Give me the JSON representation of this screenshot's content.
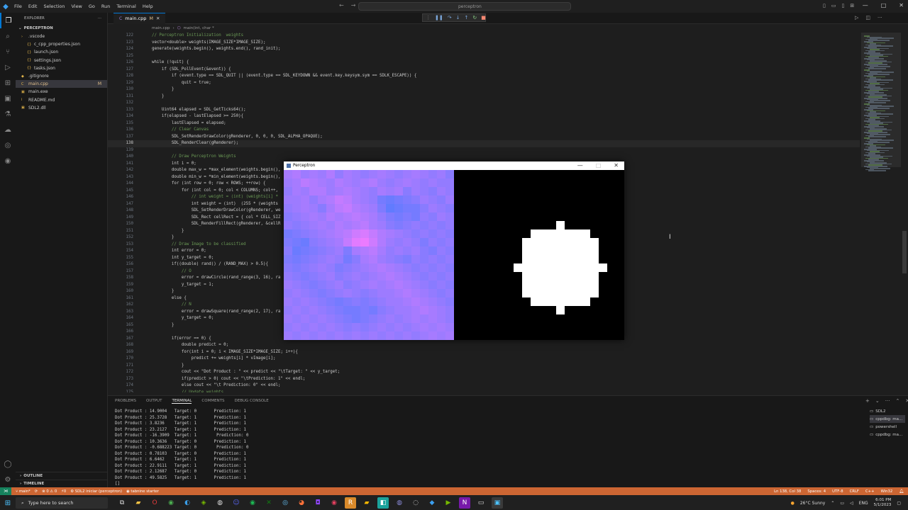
{
  "titlebar": {
    "menu": [
      "File",
      "Edit",
      "Selection",
      "View",
      "Go",
      "Run",
      "Terminal",
      "Help"
    ],
    "search_text": "perceptron",
    "window_controls": [
      "—",
      "□",
      "✕"
    ]
  },
  "sidebar": {
    "header": "EXPLORER",
    "root": "PERCEPTRON",
    "items": [
      {
        "label": ".vscode",
        "depth": 1,
        "icon": "›",
        "badge": ""
      },
      {
        "label": "c_cpp_properties.json",
        "depth": 2,
        "icon": "{}",
        "badge": ""
      },
      {
        "label": "launch.json",
        "depth": 2,
        "icon": "{}",
        "badge": ""
      },
      {
        "label": "settings.json",
        "depth": 2,
        "icon": "{}",
        "badge": ""
      },
      {
        "label": "tasks.json",
        "depth": 2,
        "icon": "{}",
        "badge": ""
      },
      {
        "label": ".gitignore",
        "depth": 1,
        "icon": "◆",
        "badge": ""
      },
      {
        "label": "main.cpp",
        "depth": 1,
        "icon": "C",
        "badge": "M"
      },
      {
        "label": "main.exe",
        "depth": 1,
        "icon": "▣",
        "badge": ""
      },
      {
        "label": "README.md",
        "depth": 1,
        "icon": "i",
        "badge": ""
      },
      {
        "label": "SDL2.dll",
        "depth": 1,
        "icon": "▣",
        "badge": ""
      }
    ],
    "outline": "OUTLINE",
    "timeline": "TIMELINE"
  },
  "tab": {
    "label": "main.cpp",
    "modified": "M"
  },
  "breadcrumb": [
    "main.cpp",
    "main(int, char *"
  ],
  "code": [
    {
      "n": "122",
      "t": "    // Perceptron Initialization  weights",
      "c": true
    },
    {
      "n": "123",
      "t": "    vector<double> weights(IMAGE_SIZE*IMAGE_SIZE);"
    },
    {
      "n": "124",
      "t": "    generate(weights.begin(), weights.end(), rand_init);"
    },
    {
      "n": "125",
      "t": ""
    },
    {
      "n": "126",
      "t": "    while (!quit) {"
    },
    {
      "n": "127",
      "t": "        if (SDL_PollEvent(&event)) {"
    },
    {
      "n": "128",
      "t": "            if (event.type == SDL_QUIT || (event.type == SDL_KEYDOWN && event.key.keysym.sym == SDLK_ESCAPE)) {"
    },
    {
      "n": "129",
      "t": "                quit = true;"
    },
    {
      "n": "130",
      "t": "            }"
    },
    {
      "n": "131",
      "t": "        }"
    },
    {
      "n": "132",
      "t": ""
    },
    {
      "n": "133",
      "t": "        Uint64 elapsed = SDL_GetTicks64();"
    },
    {
      "n": "134",
      "t": "        if(elapsed - lastElapsed >= 250){"
    },
    {
      "n": "135",
      "t": "            lastElapsed = elapsed;"
    },
    {
      "n": "136",
      "t": "            // Clear Canvas",
      "c": true
    },
    {
      "n": "137",
      "t": "            SDL_SetRenderDrawColor(gRenderer, 0, 0, 0, SDL_ALPHA_OPAQUE);"
    },
    {
      "n": "138",
      "t": "            SDL_RenderClear(gRenderer);",
      "cur": true
    },
    {
      "n": "139",
      "t": ""
    },
    {
      "n": "140",
      "t": "            // Draw Perceptron Weights",
      "c": true
    },
    {
      "n": "141",
      "t": "            int i = 0;"
    },
    {
      "n": "142",
      "t": "            double max_w = *max_element(weights.begin(),"
    },
    {
      "n": "143",
      "t": "            double min_w = *min_element(weights.begin(),"
    },
    {
      "n": "144",
      "t": "            for (int row = 0; row < ROWS; ++row) {"
    },
    {
      "n": "145",
      "t": "                for (int col = 0; col < COLUMNS; col++,"
    },
    {
      "n": "146",
      "t": "                    // int weight = (int) (weights[i] *",
      "c": true
    },
    {
      "n": "147",
      "t": "                    int weight = (int)  (255 * (weights"
    },
    {
      "n": "148",
      "t": "                    SDL_SetRenderDrawColor(gRenderer, we"
    },
    {
      "n": "149",
      "t": "                    SDL_Rect cellRect = { col * CELL_SIZ"
    },
    {
      "n": "150",
      "t": "                    SDL_RenderFillRect(gRenderer, &cellR"
    },
    {
      "n": "151",
      "t": "                }"
    },
    {
      "n": "152",
      "t": "            }"
    },
    {
      "n": "153",
      "t": "            // Draw Image to be classified",
      "c": true
    },
    {
      "n": "154",
      "t": "            int error = 0;"
    },
    {
      "n": "155",
      "t": "            int y_target = 0;"
    },
    {
      "n": "156",
      "t": "            if((double) rand() / (RAND_MAX) > 0.5){"
    },
    {
      "n": "157",
      "t": "                // O",
      "c": true
    },
    {
      "n": "158",
      "t": "                error = drawCircle(rand_range(3, 16), ra"
    },
    {
      "n": "159",
      "t": "                y_target = 1;"
    },
    {
      "n": "160",
      "t": "            }"
    },
    {
      "n": "161",
      "t": "            else {"
    },
    {
      "n": "162",
      "t": "                // N",
      "c": true
    },
    {
      "n": "163",
      "t": "                error = drawSquare(rand_range(2, 17), ra"
    },
    {
      "n": "164",
      "t": "                y_target = 0;"
    },
    {
      "n": "165",
      "t": "            }"
    },
    {
      "n": "166",
      "t": ""
    },
    {
      "n": "167",
      "t": "            if(error == 0) {"
    },
    {
      "n": "168",
      "t": "                double predict = 0;"
    },
    {
      "n": "169",
      "t": "                for(int i = 0; i < IMAGE_SIZE*IMAGE_SIZE; i++){"
    },
    {
      "n": "170",
      "t": "                    predict += weights[i] * vImage[i];"
    },
    {
      "n": "171",
      "t": "                }"
    },
    {
      "n": "172",
      "t": "                cout << \"Dot Product : \" << predict << \"\\tTarget: \" << y_target;"
    },
    {
      "n": "173",
      "t": "                if(predict > 0) cout << \"\\tPrediction: 1\" << endl;"
    },
    {
      "n": "174",
      "t": "                else cout << \"\\t Prediction: 0\" << endl;"
    },
    {
      "n": "175",
      "t": "                // Update weights",
      "c": true
    }
  ],
  "panel": {
    "tabs": [
      "PROBLEMS",
      "OUTPUT",
      "TERMINAL",
      "COMMENTS",
      "DEBUG CONSOLE"
    ],
    "active_tab": "TERMINAL",
    "terminal_lines": [
      "Dot Product : 14.9004   Target: 0       Prediction: 1",
      "Dot Product : 25.3728   Target: 1       Prediction: 1",
      "Dot Product : 3.8236    Target: 1       Prediction: 1",
      "Dot Product : 23.2127   Target: 1       Prediction: 1",
      "Dot Product : -16.3909  Target: 1        Prediction: 0",
      "Dot Product : 10.3636   Target: 0       Prediction: 1",
      "Dot Product : -0.688223 Target: 0        Prediction: 0",
      "Dot Product : 0.78103   Target: 0       Prediction: 1",
      "Dot Product : 6.6462    Target: 1       Prediction: 1",
      "Dot Product : 22.9111   Target: 1       Prediction: 1",
      "Dot Product : 2.12687   Target: 0       Prediction: 1",
      "Dot Product : 49.5825   Target: 1       Prediction: 1",
      "[]"
    ],
    "terminals": [
      "SDL2",
      "cppdbg: ma...",
      "powershell",
      "cppdbg: ma..."
    ]
  },
  "statusbar": {
    "branch": "main*",
    "sync": "⟳",
    "errors": "⊗ 0 ⚠ 0",
    "ports": "⚡0",
    "launch": "SDL2 iniciar (perceptron)",
    "tabnine": "tabnine starter",
    "position": "Ln 138, Col 38",
    "spaces": "Spaces: 4",
    "encoding": "UTF-8",
    "eol": "CRLF",
    "lang": "C++",
    "platform": "Win32"
  },
  "taskbar": {
    "search_placeholder": "Type here to search",
    "weather": "26°C  Sunny",
    "lang": "ENG",
    "time": "6:01 PM",
    "date": "5/1/2023"
  },
  "perceptron_window": {
    "title": "Perceptron",
    "colors": {
      "low": "#3a7bff",
      "high": "#ff7bff"
    },
    "grid": 20,
    "weights": [
      [
        0.55,
        0.6,
        0.5,
        0.55,
        0.5,
        0.6,
        0.45,
        0.55,
        0.5,
        0.45,
        0.5,
        0.55,
        0.5,
        0.45,
        0.5,
        0.55,
        0.5,
        0.45,
        0.5,
        0.4
      ],
      [
        0.5,
        0.55,
        0.65,
        0.6,
        0.55,
        0.5,
        0.6,
        0.55,
        0.5,
        0.55,
        0.6,
        0.5,
        0.45,
        0.5,
        0.55,
        0.5,
        0.45,
        0.5,
        0.45,
        0.45
      ],
      [
        0.45,
        0.55,
        0.5,
        0.6,
        0.6,
        0.5,
        0.55,
        0.6,
        0.55,
        0.5,
        0.45,
        0.55,
        0.5,
        0.55,
        0.4,
        0.5,
        0.45,
        0.4,
        0.5,
        0.45
      ],
      [
        0.5,
        0.5,
        0.55,
        0.45,
        0.55,
        0.6,
        0.7,
        0.65,
        0.55,
        0.5,
        0.45,
        0.3,
        0.25,
        0.3,
        0.35,
        0.4,
        0.5,
        0.45,
        0.4,
        0.5
      ],
      [
        0.45,
        0.5,
        0.55,
        0.5,
        0.4,
        0.55,
        0.65,
        0.7,
        0.6,
        0.55,
        0.5,
        0.35,
        0.2,
        0.25,
        0.3,
        0.3,
        0.4,
        0.5,
        0.45,
        0.4
      ],
      [
        0.4,
        0.45,
        0.5,
        0.55,
        0.5,
        0.6,
        0.55,
        0.6,
        0.65,
        0.6,
        0.55,
        0.45,
        0.35,
        0.3,
        0.35,
        0.3,
        0.45,
        0.4,
        0.5,
        0.45
      ],
      [
        0.45,
        0.4,
        0.45,
        0.5,
        0.55,
        0.5,
        0.6,
        0.55,
        0.6,
        0.65,
        0.55,
        0.5,
        0.4,
        0.35,
        0.4,
        0.45,
        0.4,
        0.45,
        0.4,
        0.45
      ],
      [
        0.3,
        0.35,
        0.4,
        0.45,
        0.5,
        0.55,
        0.6,
        0.65,
        0.75,
        0.8,
        0.7,
        0.6,
        0.55,
        0.5,
        0.45,
        0.4,
        0.45,
        0.4,
        0.45,
        0.4
      ],
      [
        0.35,
        0.3,
        0.25,
        0.4,
        0.45,
        0.5,
        0.55,
        0.7,
        0.85,
        0.9,
        0.75,
        0.6,
        0.5,
        0.45,
        0.5,
        0.45,
        0.35,
        0.45,
        0.4,
        0.45
      ],
      [
        0.4,
        0.25,
        0.3,
        0.35,
        0.4,
        0.45,
        0.5,
        0.35,
        0.55,
        0.6,
        0.65,
        0.55,
        0.45,
        0.5,
        0.45,
        0.5,
        0.4,
        0.35,
        0.45,
        0.4
      ],
      [
        0.35,
        0.3,
        0.35,
        0.4,
        0.45,
        0.5,
        0.45,
        0.3,
        0.4,
        0.55,
        0.6,
        0.5,
        0.45,
        0.4,
        0.35,
        0.45,
        0.4,
        0.45,
        0.4,
        0.45
      ],
      [
        0.4,
        0.35,
        0.4,
        0.45,
        0.5,
        0.45,
        0.35,
        0.4,
        0.45,
        0.5,
        0.55,
        0.6,
        0.55,
        0.5,
        0.45,
        0.4,
        0.45,
        0.4,
        0.45,
        0.4
      ],
      [
        0.45,
        0.4,
        0.35,
        0.4,
        0.45,
        0.5,
        0.4,
        0.45,
        0.5,
        0.45,
        0.5,
        0.55,
        0.6,
        0.55,
        0.5,
        0.45,
        0.4,
        0.45,
        0.4,
        0.45
      ],
      [
        0.5,
        0.45,
        0.4,
        0.35,
        0.4,
        0.45,
        0.5,
        0.4,
        0.45,
        0.5,
        0.55,
        0.5,
        0.55,
        0.6,
        0.55,
        0.5,
        0.45,
        0.4,
        0.45,
        0.4
      ],
      [
        0.45,
        0.5,
        0.45,
        0.4,
        0.35,
        0.4,
        0.45,
        0.5,
        0.45,
        0.4,
        0.45,
        0.5,
        0.5,
        0.55,
        0.6,
        0.55,
        0.5,
        0.45,
        0.4,
        0.45
      ],
      [
        0.5,
        0.45,
        0.5,
        0.45,
        0.4,
        0.35,
        0.3,
        0.35,
        0.4,
        0.35,
        0.4,
        0.45,
        0.5,
        0.5,
        0.55,
        0.6,
        0.55,
        0.5,
        0.45,
        0.4
      ],
      [
        0.45,
        0.5,
        0.45,
        0.5,
        0.45,
        0.4,
        0.35,
        0.3,
        0.3,
        0.35,
        0.3,
        0.4,
        0.45,
        0.5,
        0.5,
        0.55,
        0.6,
        0.55,
        0.5,
        0.45
      ],
      [
        0.5,
        0.45,
        0.5,
        0.45,
        0.5,
        0.45,
        0.4,
        0.35,
        0.3,
        0.35,
        0.4,
        0.45,
        0.5,
        0.45,
        0.5,
        0.55,
        0.5,
        0.55,
        0.5,
        0.45
      ],
      [
        0.45,
        0.5,
        0.45,
        0.5,
        0.45,
        0.5,
        0.45,
        0.4,
        0.45,
        0.4,
        0.45,
        0.5,
        0.45,
        0.5,
        0.45,
        0.5,
        0.55,
        0.5,
        0.55,
        0.5
      ],
      [
        0.5,
        0.45,
        0.5,
        0.45,
        0.5,
        0.45,
        0.5,
        0.45,
        0.5,
        0.45,
        0.5,
        0.45,
        0.5,
        0.45,
        0.5,
        0.45,
        0.5,
        0.55,
        0.5,
        0.55
      ]
    ],
    "shape": [
      [
        0,
        0,
        0,
        0,
        0,
        0,
        0,
        0,
        0,
        0,
        0,
        0,
        0,
        0,
        0,
        0,
        0,
        0,
        0,
        0
      ],
      [
        0,
        0,
        0,
        0,
        0,
        0,
        0,
        0,
        0,
        0,
        0,
        0,
        0,
        0,
        0,
        0,
        0,
        0,
        0,
        0
      ],
      [
        0,
        0,
        0,
        0,
        0,
        0,
        0,
        0,
        0,
        0,
        0,
        0,
        0,
        0,
        0,
        0,
        0,
        0,
        0,
        0
      ],
      [
        0,
        0,
        0,
        0,
        0,
        0,
        0,
        0,
        0,
        0,
        0,
        0,
        0,
        0,
        0,
        0,
        0,
        0,
        0,
        0
      ],
      [
        0,
        0,
        0,
        0,
        0,
        0,
        0,
        0,
        0,
        0,
        0,
        0,
        0,
        0,
        0,
        0,
        0,
        0,
        0,
        0
      ],
      [
        0,
        0,
        0,
        0,
        0,
        0,
        0,
        0,
        0,
        0,
        0,
        0,
        0,
        0,
        0,
        0,
        0,
        0,
        0,
        0
      ],
      [
        0,
        0,
        0,
        0,
        0,
        0,
        0,
        0,
        0,
        0,
        0,
        0,
        0,
        0,
        0,
        0,
        0,
        0,
        0,
        0
      ],
      [
        0,
        0,
        0,
        0,
        0,
        0,
        0,
        0,
        0,
        0,
        0,
        0,
        0,
        0,
        0,
        0,
        0,
        0,
        0,
        0
      ],
      [
        0,
        0,
        0,
        0,
        0,
        0,
        0,
        0,
        0,
        0,
        0,
        0,
        0,
        0,
        0,
        0,
        0,
        0,
        0,
        0
      ],
      [
        0,
        0,
        0,
        0,
        0,
        0,
        0,
        0,
        0,
        0,
        0,
        0,
        0,
        0,
        0,
        0,
        0,
        0,
        0,
        0
      ],
      [
        0,
        0,
        0,
        0,
        0,
        0,
        0,
        0,
        0,
        0,
        0,
        0,
        0,
        0,
        0,
        0,
        0,
        0,
        0,
        0
      ],
      [
        0,
        0,
        0,
        0,
        0,
        0,
        0,
        0,
        0,
        0,
        0,
        0,
        0,
        0,
        0,
        0,
        0,
        0,
        0,
        0
      ],
      [
        0,
        0,
        0,
        0,
        0,
        0,
        0,
        0,
        0,
        0,
        0,
        0,
        0,
        0,
        0,
        0,
        0,
        0,
        0,
        0
      ],
      [
        0,
        0,
        0,
        0,
        0,
        0,
        0,
        0,
        0,
        0,
        0,
        0,
        0,
        0,
        0,
        0,
        0,
        0,
        0,
        0
      ],
      [
        0,
        0,
        0,
        0,
        0,
        0,
        0,
        0,
        0,
        0,
        0,
        0,
        0,
        0,
        0,
        0,
        0,
        0,
        0,
        0
      ],
      [
        0,
        0,
        0,
        0,
        0,
        0,
        0,
        0,
        0,
        0,
        0,
        0,
        0,
        0,
        0,
        0,
        0,
        0,
        0,
        0
      ],
      [
        0,
        0,
        0,
        0,
        0,
        0,
        0,
        0,
        0,
        0,
        0,
        0,
        0,
        0,
        0,
        0,
        0,
        0,
        0,
        0
      ],
      [
        0,
        0,
        0,
        0,
        0,
        0,
        0,
        0,
        0,
        0,
        0,
        0,
        0,
        0,
        0,
        0,
        0,
        0,
        0,
        0
      ],
      [
        0,
        0,
        0,
        0,
        0,
        0,
        0,
        0,
        0,
        0,
        0,
        0,
        0,
        0,
        0,
        0,
        0,
        0,
        0,
        0
      ],
      [
        0,
        0,
        0,
        0,
        0,
        0,
        0,
        0,
        0,
        0,
        0,
        0,
        0,
        0,
        0,
        0,
        0,
        0,
        0,
        0
      ]
    ]
  }
}
